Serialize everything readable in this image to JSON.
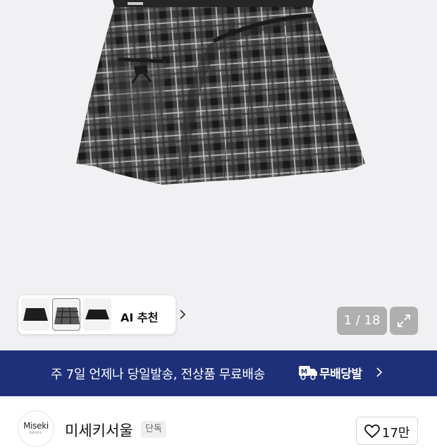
{
  "gallery": {
    "ai_recommend_label": "AI 추천",
    "counter": "1 / 18",
    "thumbnails": [
      "skirt-thumbnail-1",
      "skirt-thumbnail-2",
      "skirt-thumbnail-3"
    ]
  },
  "banner": {
    "text": "주 7일 언제나 당일발송, 전상품 무료배송",
    "badge_label": "무배당발",
    "background_color": "#1d3079"
  },
  "brand": {
    "logo_text": "Miseki",
    "logo_subtext": "SEOUL",
    "name": "미세키서울",
    "tag": "단독",
    "like_count": "17만"
  },
  "icons": {
    "chevron": "chevron-right-icon",
    "expand": "expand-icon",
    "heart": "heart-icon",
    "delivery": "delivery-truck-icon"
  }
}
